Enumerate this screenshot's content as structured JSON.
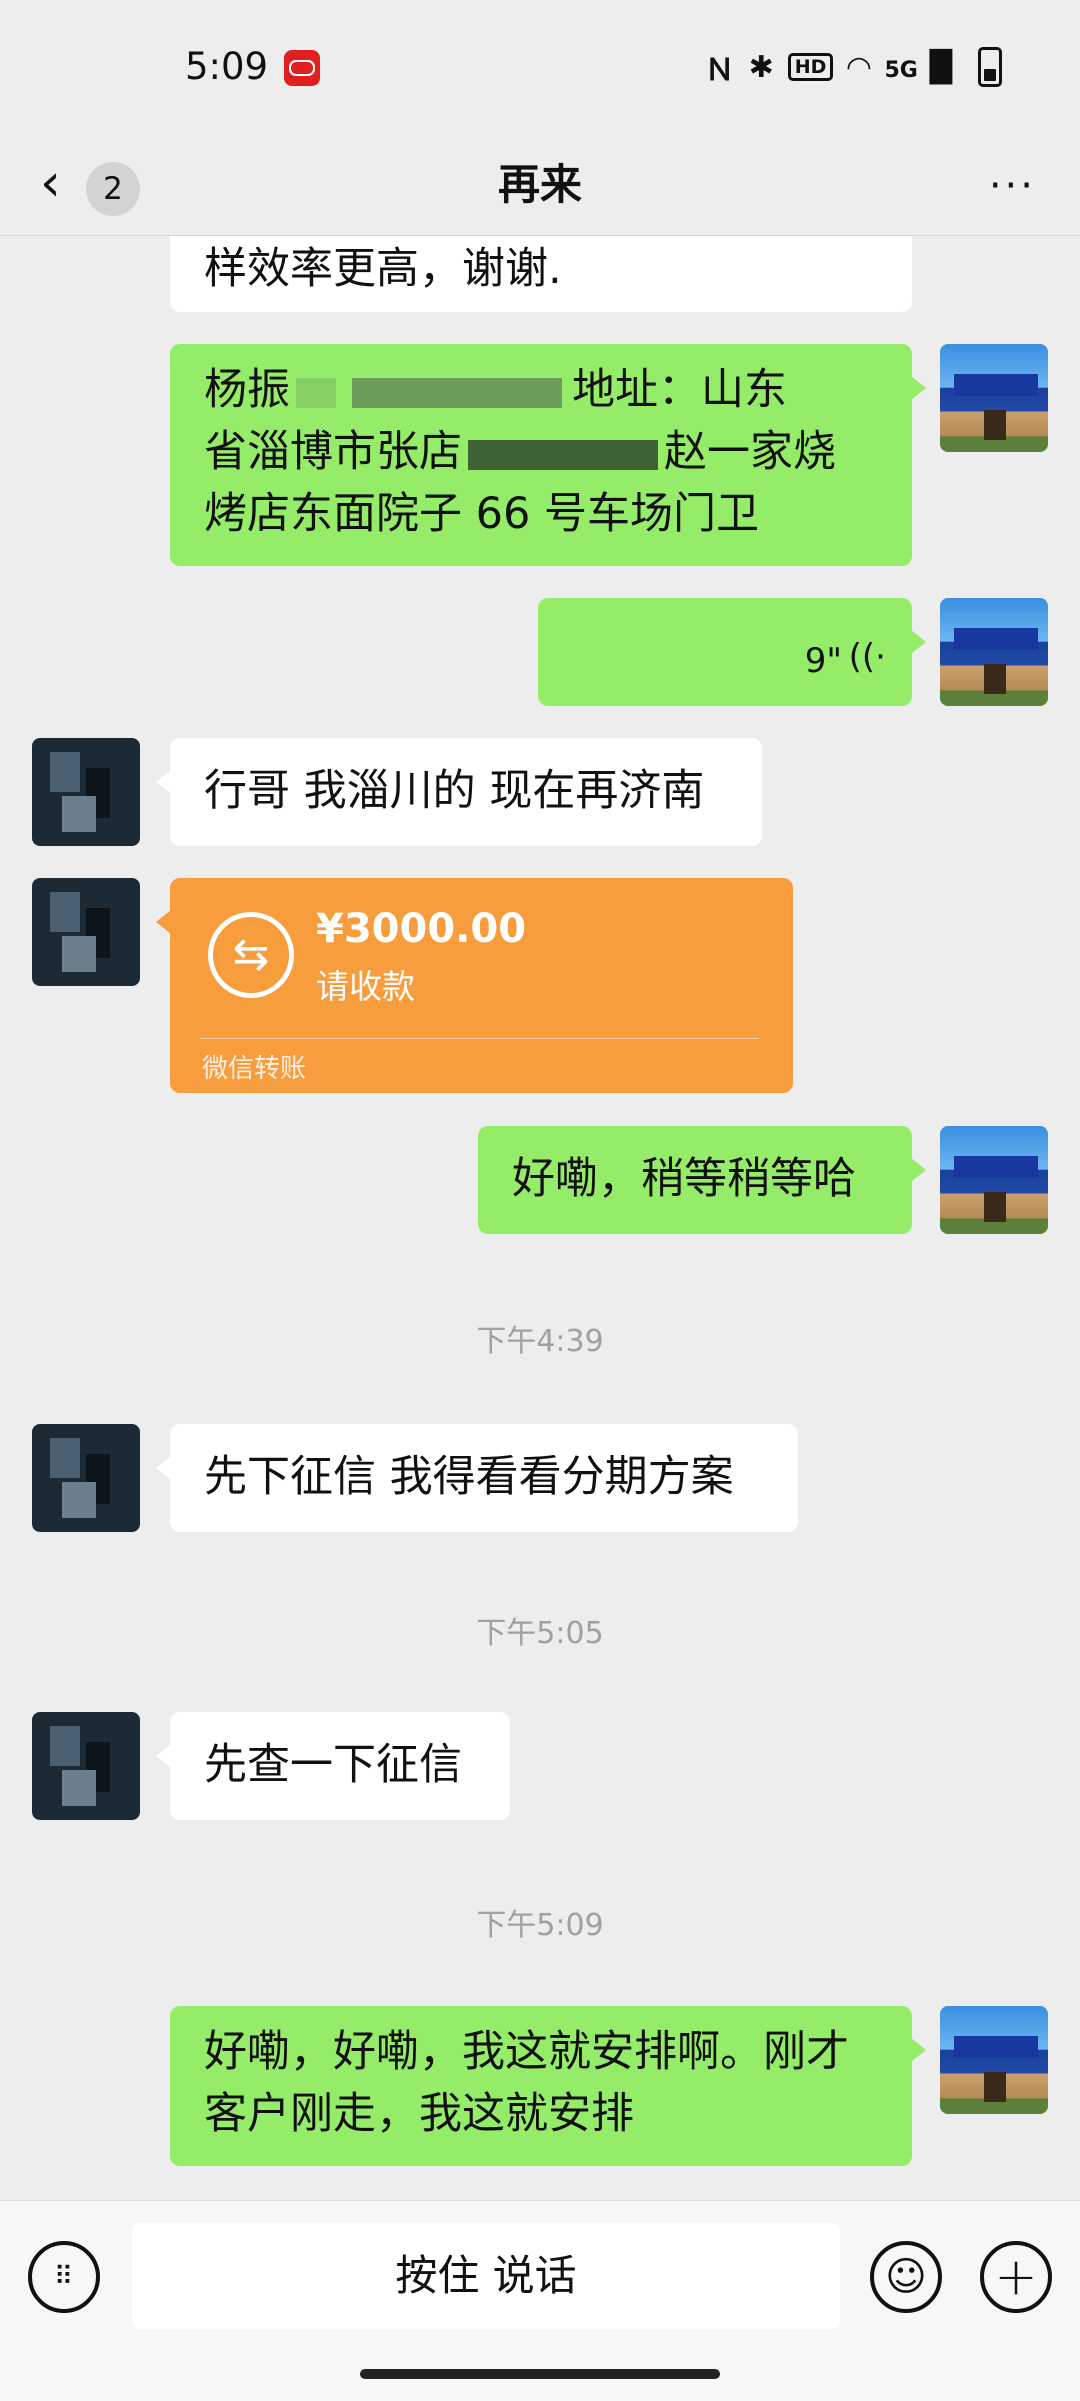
{
  "status_bar": {
    "time": "5:09",
    "icons": [
      "nfc-icon",
      "bluetooth-icon",
      "hd-icon",
      "wifi-icon",
      "5g-signal-icon",
      "battery-icon"
    ],
    "hd_label": "HD",
    "network_label": "5G"
  },
  "nav": {
    "back_count": "2",
    "title": "再来",
    "more_label": "···"
  },
  "messages": {
    "m1": "样效率更高，谢谢.",
    "m2_line1_start": "杨振",
    "m2_line1_end": "地址：山东",
    "m2_line2_start": "省淄博市张店",
    "m2_line2_end": "赵一家烧",
    "m2_line3": "烤店东面院子 66 号车场门卫",
    "m3_voice_duration": "9\"",
    "m4": "行哥 我淄川的 现在再济南",
    "m5_transfer": {
      "amount": "¥3000.00",
      "status": "请收款",
      "footer": "微信转账"
    },
    "m6": "好嘞，稍等稍等哈",
    "t1": "下午4:39",
    "m7": "先下征信 我得看看分期方案",
    "t2": "下午5:05",
    "m8": "先查一下征信",
    "t3": "下午5:09",
    "m9_line1": "好嘞，好嘞，我这就安排啊。刚才",
    "m9_line2": "客户刚走，我这就安排"
  },
  "input_bar": {
    "hold_to_talk": "按住 说话"
  },
  "colors": {
    "sent_bubble": "#95ec69",
    "received_bubble": "#ffffff",
    "transfer": "#f79d3d",
    "background": "#ededed"
  }
}
